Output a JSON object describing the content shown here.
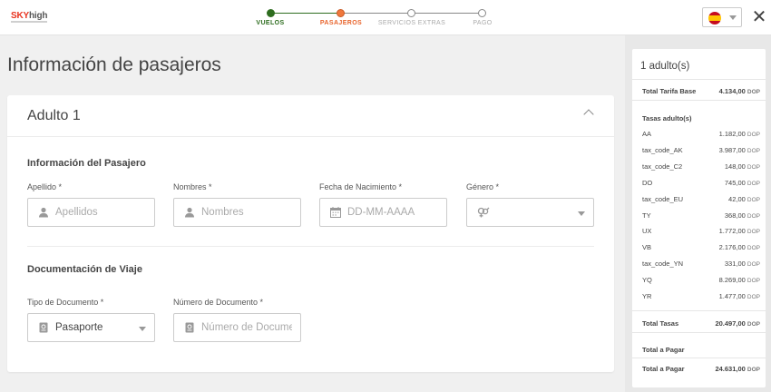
{
  "brand": {
    "sky": "SKY",
    "high": "high"
  },
  "steps": [
    {
      "label": "VUELOS",
      "state": "done"
    },
    {
      "label": "PASAJEROS",
      "state": "active"
    },
    {
      "label": "SERVICIOS EXTRAS",
      "state": "pending"
    },
    {
      "label": "PAGO",
      "state": "pending"
    }
  ],
  "close_label": "✕",
  "page_title": "Información de pasajeros",
  "card": {
    "title": "Adulto 1",
    "passenger_section": "Información del Pasajero",
    "fields": {
      "apellido": {
        "label": "Apellido *",
        "placeholder": "Apellidos"
      },
      "nombres": {
        "label": "Nombres *",
        "placeholder": "Nombres"
      },
      "fecha": {
        "label": "Fecha de Nacimiento *",
        "placeholder": "DD-MM-AAAA"
      },
      "genero": {
        "label": "Género *",
        "placeholder": ""
      }
    },
    "travel_section": "Documentación de Viaje",
    "doc_type": {
      "label": "Tipo de Documento *",
      "value": "Pasaporte"
    },
    "doc_number": {
      "label": "Número de Documento *",
      "placeholder": "Número de Documento"
    }
  },
  "summary": {
    "title": "1 adulto(s)",
    "base_fare": {
      "label": "Total Tarifa Base",
      "amount": "4.134,00",
      "currency": "DOP"
    },
    "taxes_label": "Tasas adulto(s)",
    "taxes": [
      {
        "code": "AA",
        "amount": "1.182,00",
        "currency": "DOP"
      },
      {
        "code": "tax_code_AK",
        "amount": "3.987,00",
        "currency": "DOP"
      },
      {
        "code": "tax_code_C2",
        "amount": "148,00",
        "currency": "DOP"
      },
      {
        "code": "DO",
        "amount": "745,00",
        "currency": "DOP"
      },
      {
        "code": "tax_code_EU",
        "amount": "42,00",
        "currency": "DOP"
      },
      {
        "code": "TY",
        "amount": "368,00",
        "currency": "DOP"
      },
      {
        "code": "UX",
        "amount": "1.772,00",
        "currency": "DOP"
      },
      {
        "code": "VB",
        "amount": "2.176,00",
        "currency": "DOP"
      },
      {
        "code": "tax_code_YN",
        "amount": "331,00",
        "currency": "DOP"
      },
      {
        "code": "YQ",
        "amount": "8.269,00",
        "currency": "DOP"
      },
      {
        "code": "YR",
        "amount": "1.477,00",
        "currency": "DOP"
      }
    ],
    "total_taxes": {
      "label": "Total Tasas",
      "amount": "20.497,00",
      "currency": "DOP"
    },
    "to_pay_label": "Total a Pagar",
    "total_to_pay": {
      "label": "Total a Pagar",
      "amount": "24.631,00",
      "currency": "DOP"
    }
  },
  "colors": {
    "accent": "#e8642c",
    "done": "#2e6d1f",
    "brand_red": "#e8321e"
  }
}
